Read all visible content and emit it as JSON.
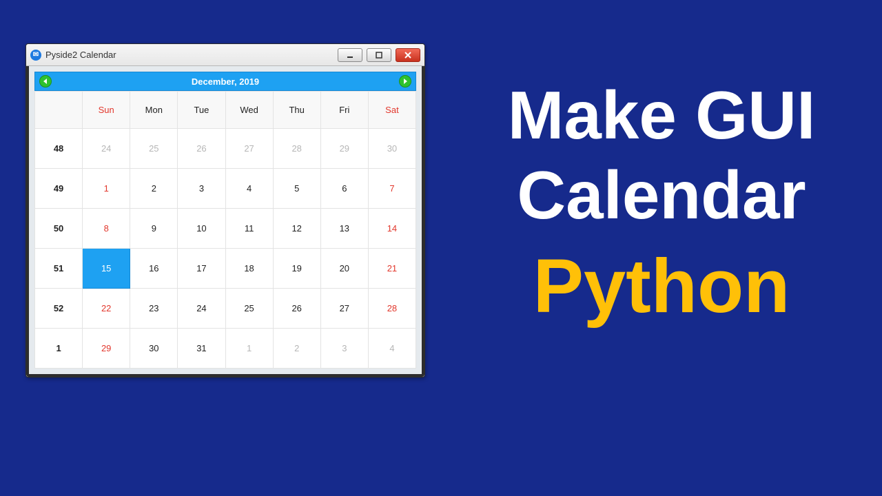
{
  "headline": {
    "line1a": "Make ",
    "line1b": "GUI",
    "line2": "Calendar",
    "line3": "Python"
  },
  "window": {
    "title": "Pyside2 Calendar",
    "appicon_glyph": "✉"
  },
  "calendar": {
    "nav_label": "December,   2019",
    "day_headers": [
      "",
      "Sun",
      "Mon",
      "Tue",
      "Wed",
      "Thu",
      "Fri",
      "Sat"
    ],
    "rows": [
      {
        "wk": "48",
        "cells": [
          {
            "n": "24",
            "out": true
          },
          {
            "n": "25",
            "out": true
          },
          {
            "n": "26",
            "out": true
          },
          {
            "n": "27",
            "out": true
          },
          {
            "n": "28",
            "out": true
          },
          {
            "n": "29",
            "out": true
          },
          {
            "n": "30",
            "out": true
          }
        ]
      },
      {
        "wk": "49",
        "cells": [
          {
            "n": "1",
            "weekend": true
          },
          {
            "n": "2"
          },
          {
            "n": "3"
          },
          {
            "n": "4"
          },
          {
            "n": "5"
          },
          {
            "n": "6"
          },
          {
            "n": "7",
            "weekend": true
          }
        ]
      },
      {
        "wk": "50",
        "cells": [
          {
            "n": "8",
            "weekend": true
          },
          {
            "n": "9"
          },
          {
            "n": "10"
          },
          {
            "n": "11"
          },
          {
            "n": "12"
          },
          {
            "n": "13"
          },
          {
            "n": "14",
            "weekend": true
          }
        ]
      },
      {
        "wk": "51",
        "cells": [
          {
            "n": "15",
            "sel": true
          },
          {
            "n": "16"
          },
          {
            "n": "17"
          },
          {
            "n": "18"
          },
          {
            "n": "19"
          },
          {
            "n": "20"
          },
          {
            "n": "21",
            "weekend": true
          }
        ]
      },
      {
        "wk": "52",
        "cells": [
          {
            "n": "22",
            "weekend": true
          },
          {
            "n": "23"
          },
          {
            "n": "24"
          },
          {
            "n": "25"
          },
          {
            "n": "26"
          },
          {
            "n": "27"
          },
          {
            "n": "28",
            "weekend": true
          }
        ]
      },
      {
        "wk": "1",
        "cells": [
          {
            "n": "29",
            "weekend": true
          },
          {
            "n": "30"
          },
          {
            "n": "31"
          },
          {
            "n": "1",
            "out": true
          },
          {
            "n": "2",
            "out": true
          },
          {
            "n": "3",
            "out": true
          },
          {
            "n": "4",
            "out": true
          }
        ]
      }
    ]
  }
}
